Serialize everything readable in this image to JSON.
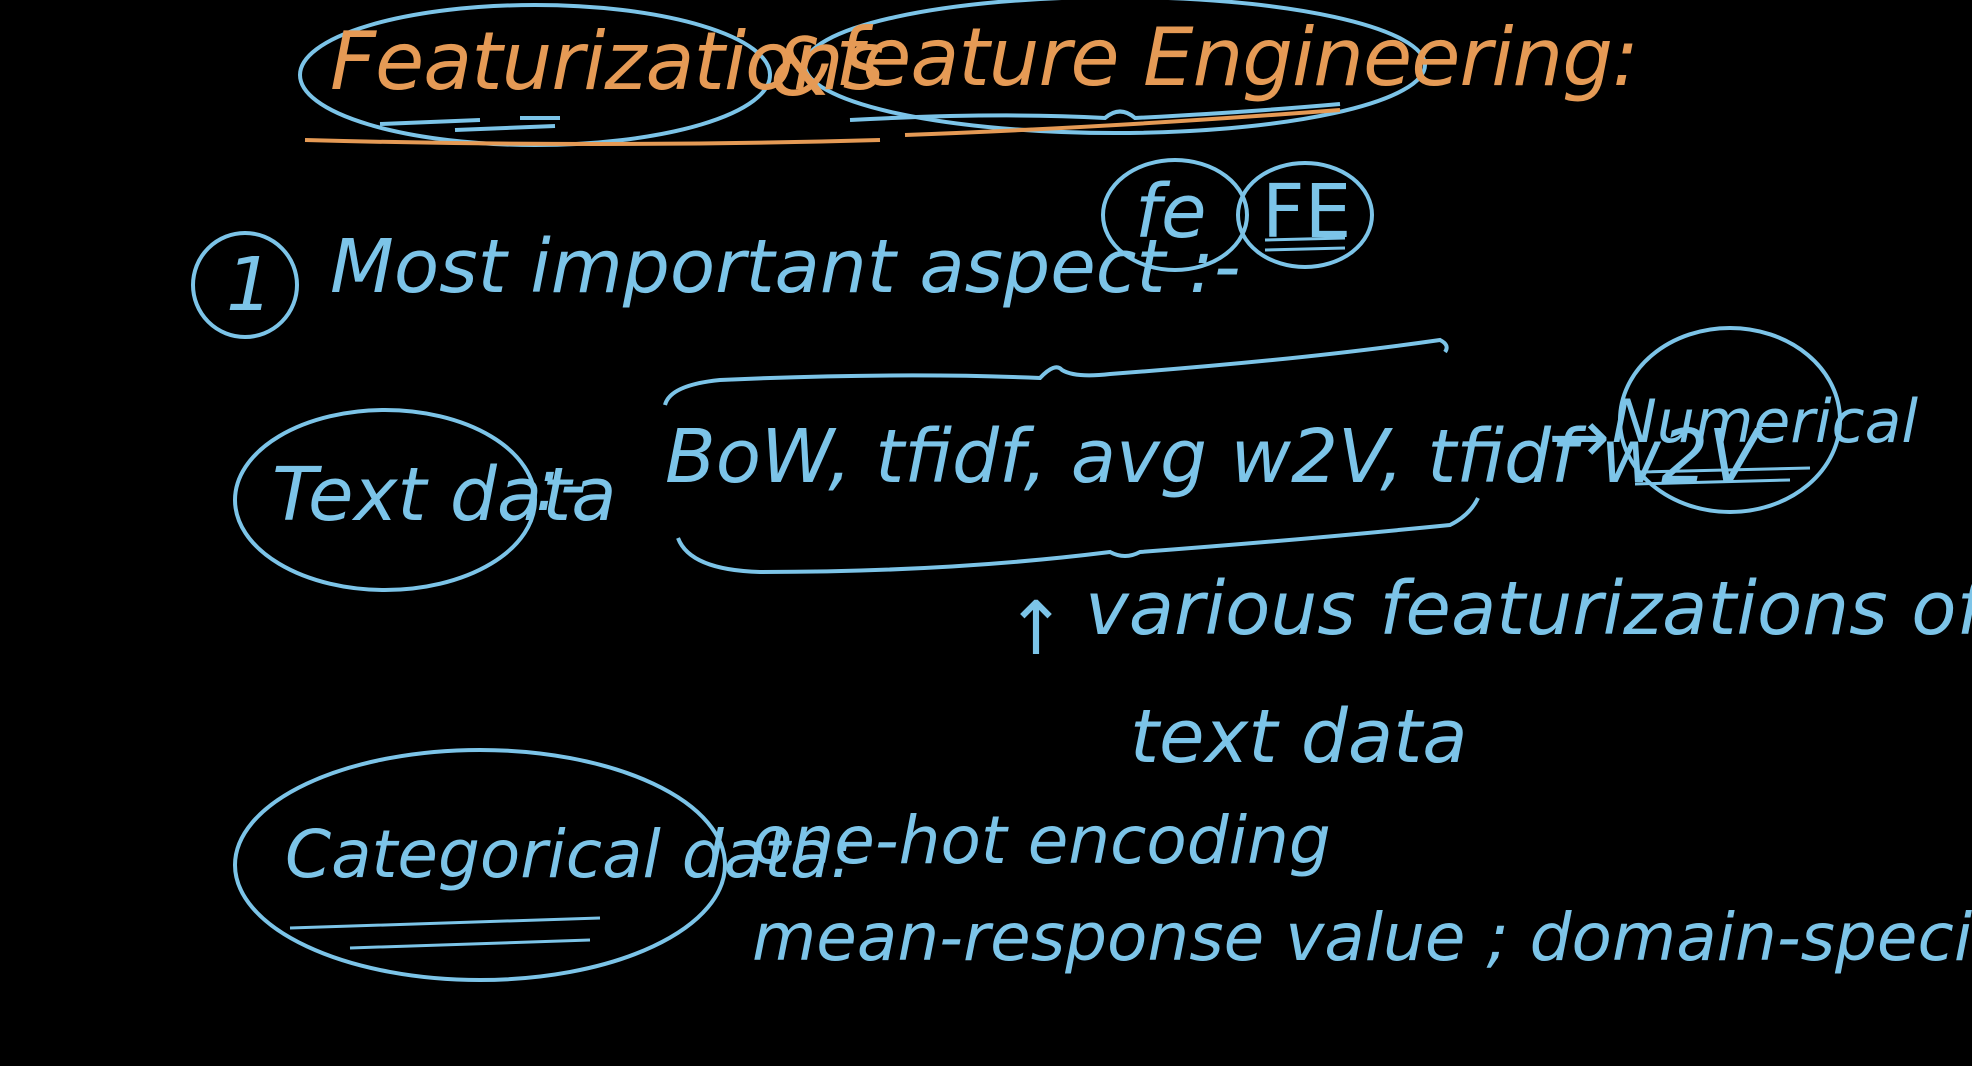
{
  "title": {
    "featurizations": "Featurizations",
    "ampersand": "&",
    "feature_engineering": "feature Engineering:"
  },
  "point1": {
    "number": "1",
    "text": "Most important aspect :-",
    "fe_lower": "fe",
    "fe_upper": "FE"
  },
  "text_data": {
    "label": "Text data",
    "sep": ":-",
    "methods": "BoW, tfidf, avg w2V, tfidf w2V",
    "arrow": "→",
    "result": "Numerical",
    "note_arrow": "↑",
    "note_line1": "various featurizations of",
    "note_line2": "text data"
  },
  "categorical": {
    "label": "Categorical data:",
    "line1": "one-hot encoding",
    "line2": "mean-response value ; domain-specific"
  },
  "colors": {
    "blue_ink": "#7cc4e8",
    "orange_ink": "#e59a55",
    "background": "#000000"
  }
}
